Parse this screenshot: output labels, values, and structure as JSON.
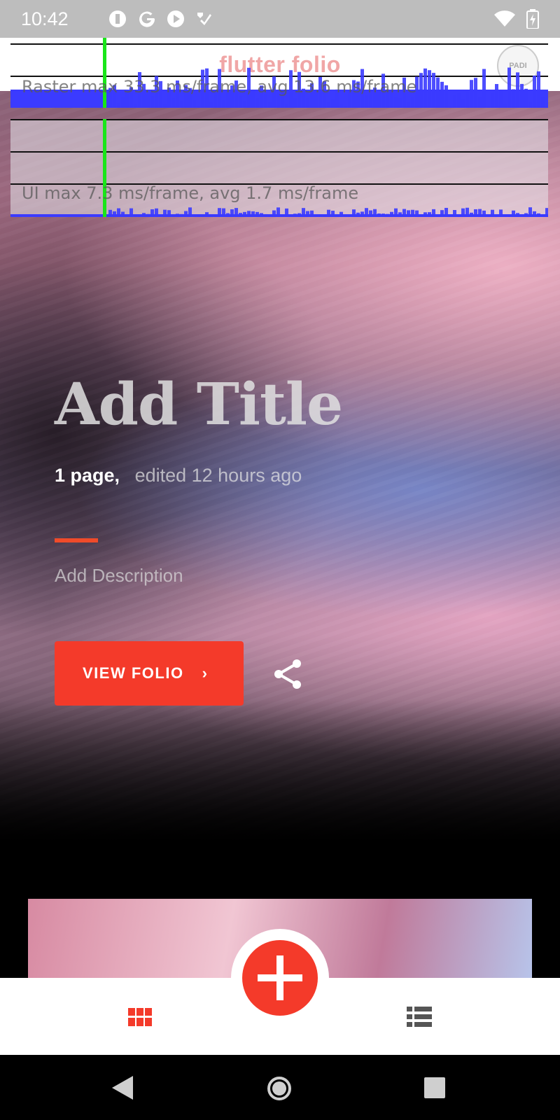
{
  "status_bar": {
    "time": "10:42",
    "left_icons": [
      "notification-icon",
      "google-icon",
      "play-icon",
      "tasks-icon"
    ],
    "right_icons": [
      "wifi-icon",
      "battery-charging-icon"
    ]
  },
  "app_header": {
    "title": "flutter folio",
    "logo_text": "PADI"
  },
  "perf_overlay": {
    "raster_label": "Raster  max 33.3 ms/frame, avg 13.6 ms/frame",
    "ui_label": "UI  max 7.3 ms/frame, avg 1.7 ms/frame",
    "bar_color": "#3b3bff",
    "marker_color": "#19e619"
  },
  "folio": {
    "title": "Add Title",
    "pages": "1 page,",
    "edited": "edited 12 hours ago",
    "description": "Add Description",
    "view_button": "VIEW FOLIO",
    "view_button_chevron": "›"
  },
  "colors": {
    "accent": "#f43a2a",
    "accent_line": "#f04b2a"
  },
  "bottom_nav": {
    "left_icon": "grid-icon",
    "center_icon": "add-icon",
    "right_icon": "list-icon"
  },
  "system_nav": [
    "back-icon",
    "home-icon",
    "recents-icon"
  ]
}
